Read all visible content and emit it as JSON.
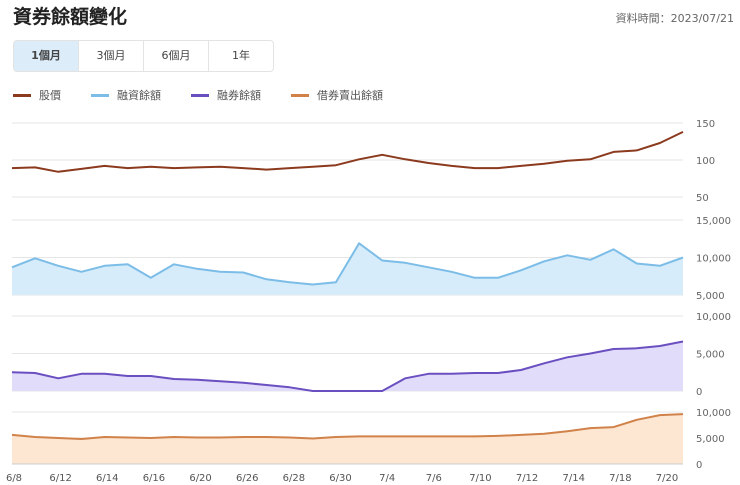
{
  "title": "資券餘額變化",
  "date_label": "資料時間：2023/07/21",
  "tabs": [
    {
      "label": "1個月",
      "active": true
    },
    {
      "label": "3個月"
    },
    {
      "label": "6個月"
    },
    {
      "label": "1年"
    }
  ],
  "chart_data": {
    "type": "line",
    "x_tick_labels": [
      "6/8",
      "6/12",
      "6/14",
      "6/16",
      "6/20",
      "6/26",
      "6/28",
      "6/30",
      "7/4",
      "7/6",
      "7/10",
      "7/12",
      "7/14",
      "7/18",
      "7/20"
    ],
    "series": [
      {
        "name": "股價",
        "color": "#8b3a1e",
        "fill": false,
        "ylim": [
          50,
          150
        ],
        "yticks": [
          "150",
          "100",
          "50"
        ],
        "ytick_values": [
          150,
          100,
          50
        ],
        "values": [
          89,
          90,
          84,
          88,
          92,
          89,
          91,
          89,
          90,
          91,
          89,
          87,
          89,
          91,
          93,
          101,
          107,
          101,
          96,
          92,
          89,
          89,
          92,
          95,
          99,
          101,
          111,
          113,
          123,
          138
        ]
      },
      {
        "name": "融資餘額",
        "color": "#7cbde8",
        "fillColor": "#d6ecfa",
        "fill": true,
        "ylim": [
          5000,
          15000
        ],
        "yticks": [
          "15,000",
          "10,000",
          "5,000"
        ],
        "ytick_values": [
          15000,
          10000,
          5000
        ],
        "values": [
          8700,
          9900,
          8900,
          8100,
          8900,
          9100,
          7300,
          9100,
          8500,
          8100,
          8000,
          7100,
          6700,
          6400,
          6700,
          11900,
          9600,
          9300,
          8700,
          8100,
          7300,
          7300,
          8300,
          9500,
          10300,
          9700,
          11100,
          9200,
          8900,
          10000
        ]
      },
      {
        "name": "融券餘額",
        "color": "#6a4fc0",
        "fillColor": "#e2dcfb",
        "fill": true,
        "ylim": [
          0,
          10000
        ],
        "yticks": [
          "10,000",
          "5,000",
          "0"
        ],
        "ytick_values": [
          10000,
          5000,
          0
        ],
        "values": [
          2500,
          2400,
          1700,
          2300,
          2300,
          2000,
          2000,
          1600,
          1500,
          1300,
          1100,
          800,
          500,
          0,
          0,
          0,
          0,
          1700,
          2300,
          2300,
          2400,
          2400,
          2800,
          3700,
          4500,
          5000,
          5600,
          5700,
          6000,
          6600
        ]
      },
      {
        "name": "借券賣出餘額",
        "color": "#d0824a",
        "fillColor": "#fde6d2",
        "fill": true,
        "ylim": [
          0,
          10000
        ],
        "yticks": [
          "10,000",
          "5,000",
          "0"
        ],
        "ytick_values": [
          10000,
          5000,
          0
        ],
        "values": [
          5600,
          5200,
          5000,
          4800,
          5200,
          5100,
          5000,
          5200,
          5100,
          5100,
          5200,
          5200,
          5100,
          4900,
          5200,
          5300,
          5300,
          5300,
          5300,
          5300,
          5300,
          5400,
          5600,
          5800,
          6300,
          6900,
          7100,
          8500,
          9400,
          9600
        ]
      }
    ]
  }
}
